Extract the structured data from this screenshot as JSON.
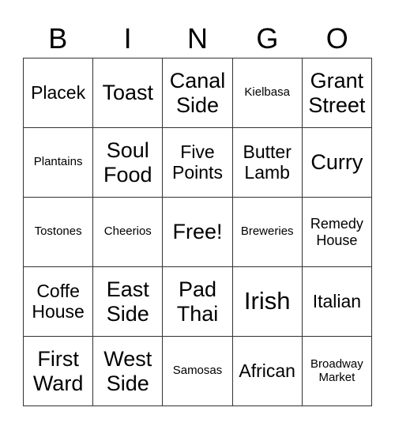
{
  "header": {
    "letters": [
      "B",
      "I",
      "N",
      "G",
      "O"
    ]
  },
  "grid": {
    "rows": [
      [
        "Placek",
        "Toast",
        "Canal Side",
        "Kielbasa",
        "Grant Street"
      ],
      [
        "Plantains",
        "Soul Food",
        "Five Points",
        "Butter Lamb",
        "Curry"
      ],
      [
        "Tostones",
        "Cheerios",
        "Free!",
        "Breweries",
        "Remedy House"
      ],
      [
        "Coffe House",
        "East Side",
        "Pad Thai",
        "Irish",
        "Italian"
      ],
      [
        "First Ward",
        "West Side",
        "Samosas",
        "African",
        "Broadway Market"
      ]
    ]
  }
}
